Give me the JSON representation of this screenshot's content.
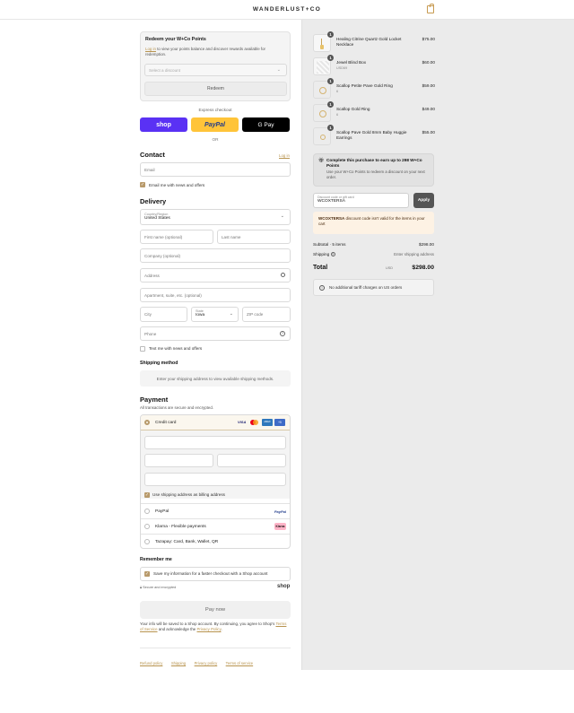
{
  "brand": {
    "name": "WANDERLUST+CO"
  },
  "points": {
    "title": "Redeem your W+Co Points",
    "login_link": "Log in",
    "description_rest": " to view your points balance and discover rewards available for redemption.",
    "select_placeholder": "Select a discount",
    "redeem_label": "Redeem"
  },
  "express": {
    "label": "Express checkout",
    "shop_label": "shop",
    "paypal_label": "PayPal",
    "gpay_label": "G Pay",
    "or_label": "OR"
  },
  "contact": {
    "heading": "Contact",
    "login_link": "Log in",
    "email_placeholder": "Email",
    "news_label": "Email me with news and offers"
  },
  "delivery": {
    "heading": "Delivery",
    "country_label": "Country/Region",
    "country_value": "United States",
    "first_name": "First name (optional)",
    "last_name": "Last name",
    "company": "Company (optional)",
    "address": "Address",
    "apartment": "Apartment, suite, etc. (optional)",
    "city": "City",
    "state_label": "State",
    "state_value": "Iowa",
    "zip": "ZIP code",
    "phone": "Phone",
    "text_label": "Text me with news and offers"
  },
  "shipping": {
    "heading": "Shipping method",
    "message": "Enter your shipping address to view available shipping methods."
  },
  "payment": {
    "heading": "Payment",
    "subtitle": "All transactions are secure and encrypted.",
    "credit_card": "Credit card",
    "card_brands": [
      "VISA",
      "MC",
      "AMEX",
      "+5"
    ],
    "billing_label": "Use shipping address as billing address",
    "paypal": "PayPal",
    "paypal_badge": "PayPal",
    "klarna": "Klarna - Flexible payments",
    "klarna_badge": "Klarna",
    "tazapay": "Tazapay: Card, Bank, Wallet, QR"
  },
  "remember": {
    "heading": "Remember me",
    "save_label": "Save my information for a faster checkout with a Shop account",
    "secure_label": "Secure and encrypted",
    "shop_label": "shop"
  },
  "pay": {
    "button_label": "Pay now",
    "notice_start": "Your info will be saved to a Shop account. By continuing, you agree to Shop's ",
    "terms_link": "Terms of Service",
    "notice_mid": " and acknowledge the ",
    "privacy_link": "Privacy Policy",
    "notice_end": "."
  },
  "footer_links": [
    "Refund policy",
    "Shipping",
    "Privacy policy",
    "Terms of service"
  ],
  "cart": {
    "items": [
      {
        "qty": "1",
        "name": "Healing Citrine Quartz Gold Locket Necklace",
        "sub": "",
        "price": "$75.00"
      },
      {
        "qty": "1",
        "name": "Jewel Blind Box",
        "sub": "USD69",
        "price": "$60.00"
      },
      {
        "qty": "1",
        "name": "Scallop Petite Pave Gold Ring",
        "sub": "6",
        "price": "$59.00"
      },
      {
        "qty": "1",
        "name": "Scallop Gold Ring",
        "sub": "6",
        "price": "$49.00"
      },
      {
        "qty": "1",
        "name": "Scallop Pave Gold 8mm Baby Huggie Earrings",
        "sub": "",
        "price": "$55.00"
      }
    ],
    "earn_title": "Complete this purchase to earn up to 298 W+Co Points",
    "earn_text": "Use your W+Co Points to redeem a discount on your next order.",
    "discount_label": "Discount code or gift card",
    "discount_value": "WCOXTERSA",
    "apply_label": "Apply",
    "error_code": "WCOXTERSA",
    "error_text": " discount code isn't valid for the items in your cart",
    "subtotal_label": "Subtotal · 5 items",
    "subtotal_value": "$298.00",
    "shipping_label": "Shipping",
    "shipping_value": "Enter shipping address",
    "total_label": "Total",
    "currency": "USD",
    "total_value": "$298.00",
    "tariff_text": "No additional tariff charges on US orders"
  },
  "colors": {
    "accent": "#b8944f",
    "shop": "#5a31f4",
    "paypal": "#ffc439",
    "error_bg": "#fdf2e4"
  }
}
